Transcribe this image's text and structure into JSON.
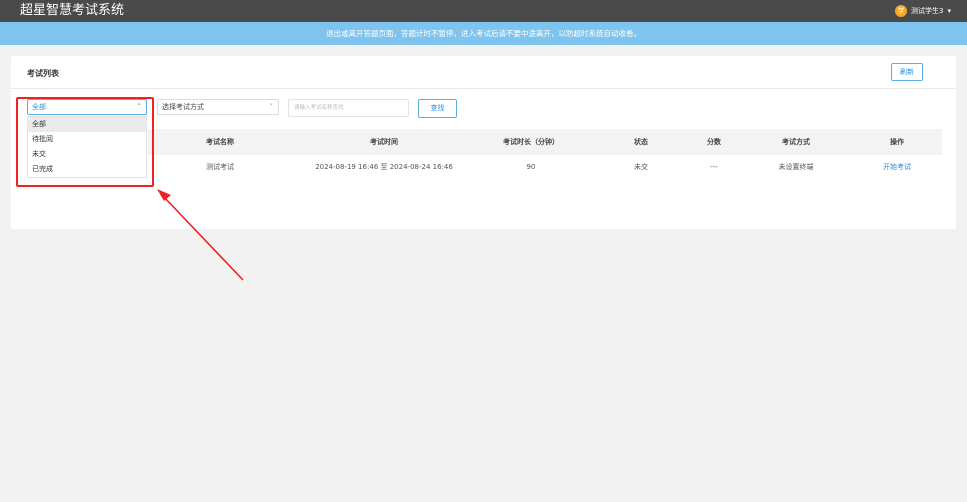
{
  "header": {
    "app_title": "超星智慧考试系统",
    "user_avatar_text": "学",
    "user_name": "测试学生3",
    "user_caret": "▾"
  },
  "notice": {
    "text": "退出或离开答题页面，答题计时不暂停，进入考试后请不要中途离开，以防超时系统自动收卷。"
  },
  "exam_list": {
    "title": "考试列表",
    "refresh_label": "刷新",
    "filters": {
      "status_selected": "全部",
      "status_options": [
        "全部",
        "待批阅",
        "未交",
        "已完成"
      ],
      "mode_selected": "选择考试方式",
      "search_placeholder": "请输入考试名称查找",
      "search_value": "",
      "search_button": "查找"
    },
    "columns": [
      "考试名称",
      "考试时间",
      "考试时长（分钟）",
      "状态",
      "分数",
      "考试方式",
      "操作"
    ],
    "rows": [
      {
        "name": "测试考试",
        "time": "2024-08-19 16:46 至 2024-08-24 16:46",
        "duration": "90",
        "status": "未交",
        "score": "---",
        "mode": "未设置终端",
        "action": "开始考试"
      }
    ]
  },
  "icons": {
    "chevron_up": "˄",
    "chevron_down": "˅"
  },
  "colors": {
    "topbar": "#4a4a4a",
    "notice_bg": "#7fc4ee",
    "accent": "#2a8ce0",
    "annotation_red": "#ee2222"
  }
}
